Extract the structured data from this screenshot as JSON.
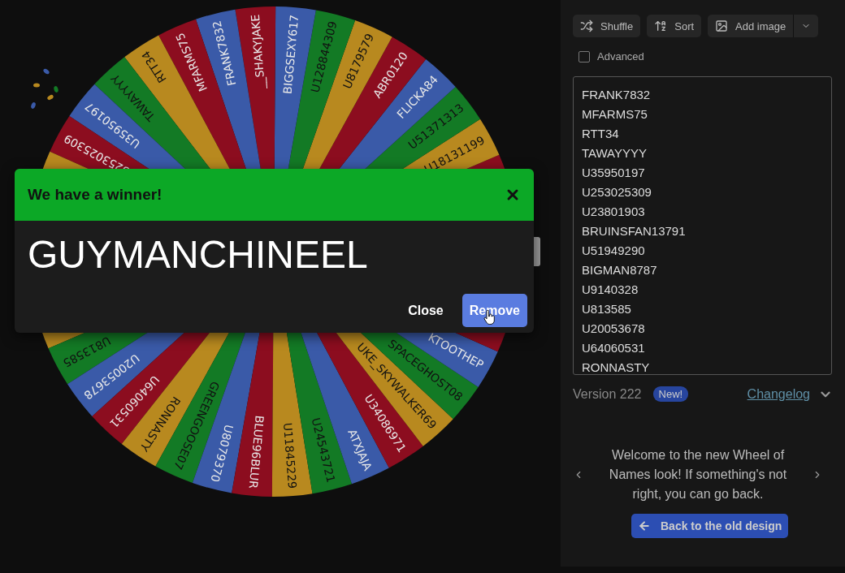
{
  "wheel": {
    "upper_segments": [
      {
        "color": "#8c0d1f"
      },
      {
        "name": "U18131199",
        "color": "#b8891f"
      },
      {
        "name": "U51371313",
        "color": "#137a25"
      },
      {
        "name": "FLICKA84",
        "color": "#3a5aa8"
      },
      {
        "name": "ABR0120",
        "color": "#8c0d1f"
      },
      {
        "name": "U8179579",
        "color": "#b8891f"
      },
      {
        "name": "U128844309",
        "color": "#137a25"
      },
      {
        "name": "BIGGSEXY617",
        "color": "#3a5aa8"
      },
      {
        "name": "__SHAKYJAKE",
        "color": "#8c0d1f"
      },
      {
        "name": "FRANK7832",
        "color": "#3a5aa8"
      },
      {
        "name": "MFARMS75",
        "color": "#8c0d1f"
      },
      {
        "name": "RTT34",
        "color": "#b8891f"
      },
      {
        "name": "TAWAYYYY",
        "color": "#137a25"
      },
      {
        "name": "U35950197",
        "color": "#3a5aa8"
      },
      {
        "name": "U253025309",
        "color": "#8c0d1f"
      },
      {
        "color": "#b8891f"
      }
    ],
    "lower_segments": [
      {
        "color": "#b8891f"
      },
      {
        "name": "U813585",
        "color": "#137a25"
      },
      {
        "name": "U20053678",
        "color": "#3a5aa8"
      },
      {
        "name": "U64060531",
        "color": "#8c0d1f"
      },
      {
        "name": "RONNASTY",
        "color": "#b8891f"
      },
      {
        "name": "GREENGOOSE07",
        "color": "#137a25"
      },
      {
        "name": "U8079370",
        "color": "#3a5aa8"
      },
      {
        "name": "BLUE96BLUR",
        "color": "#8c0d1f"
      },
      {
        "name": "U11845229",
        "color": "#b8891f"
      },
      {
        "name": "U24543721",
        "color": "#137a25"
      },
      {
        "name": "ATXJAJA",
        "color": "#3a5aa8"
      },
      {
        "name": "U34086971",
        "color": "#8c0d1f"
      },
      {
        "name": "UKE_SKYWALKER69",
        "color": "#b8891f"
      },
      {
        "name": "SPACEGHOST08",
        "color": "#137a25"
      },
      {
        "name": "KTOOTHEP",
        "color": "#3a5aa8"
      },
      {
        "color": "#8c0d1f"
      }
    ]
  },
  "winner_dialog": {
    "title": "We have a winner!",
    "winner": "GUYMANCHINEEL",
    "buttons": [
      {
        "label": "Close",
        "kind": "text"
      },
      {
        "label": "Remove",
        "kind": "primary"
      }
    ]
  },
  "toolbar": {
    "buttons": [
      {
        "label": "Shuffle",
        "kind": "shuffle"
      },
      {
        "label": "Sort",
        "kind": "sort"
      },
      {
        "label": "Add image",
        "kind": "image"
      },
      {
        "kind": "menu"
      }
    ]
  },
  "advanced": {
    "label": "Advanced",
    "checked": false
  },
  "names": [
    "FRANK7832",
    "MFARMS75",
    "RTT34",
    "TAWAYYYY",
    "U35950197",
    "U253025309",
    "U23801903",
    "BRUINSFAN13791",
    "U51949290",
    "BIGMAN8787",
    "U9140328",
    "U813585",
    "U20053678",
    "U64060531",
    "RONNASTY"
  ],
  "version": {
    "label": "Version 222",
    "badge": "New!",
    "link": "Changelog"
  },
  "announcement": {
    "text": "Welcome to the new Wheel of Names look! If something's not right, you can go back.",
    "button": "Back to the old design"
  }
}
